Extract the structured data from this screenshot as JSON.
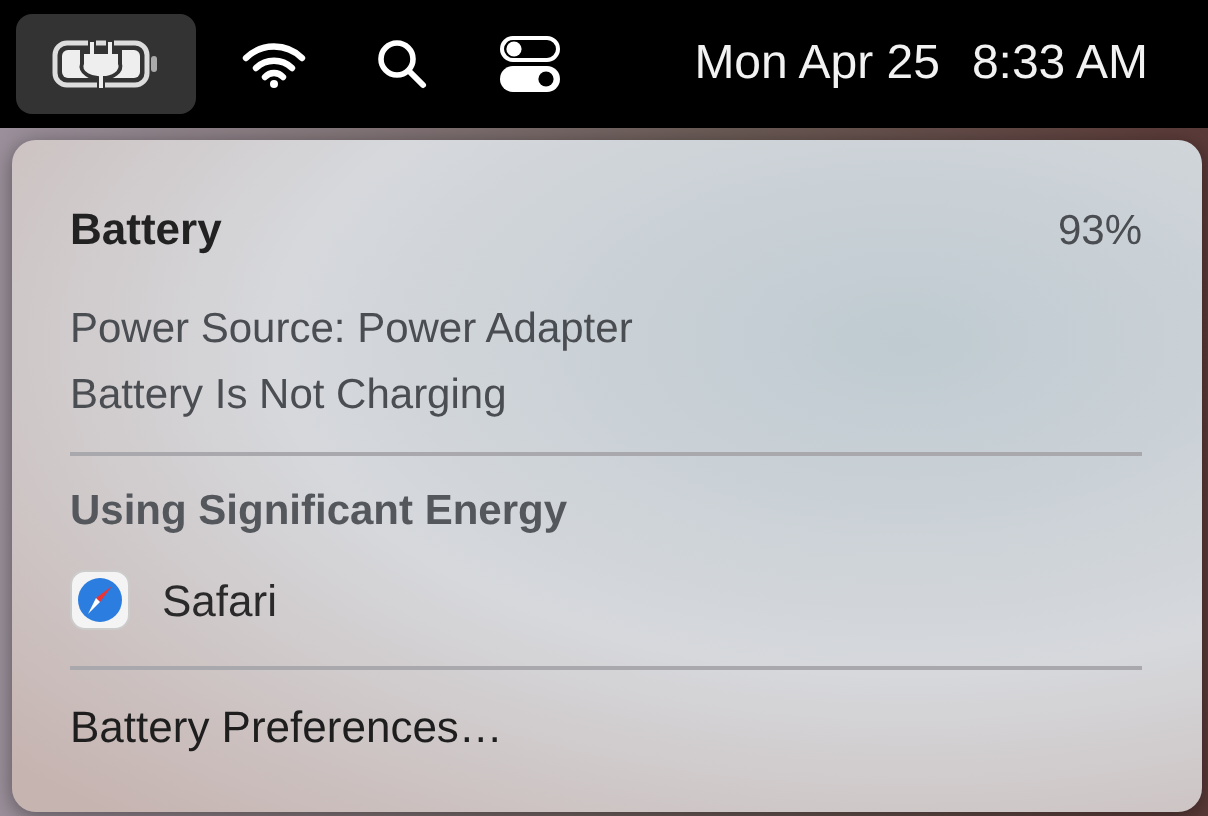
{
  "menu_bar": {
    "status_items": [
      {
        "kind": "battery",
        "selected": true
      },
      {
        "kind": "wifi",
        "selected": false
      },
      {
        "kind": "search",
        "selected": false
      },
      {
        "kind": "control-center",
        "selected": false
      }
    ],
    "date": "Mon Apr 25",
    "time": "8:33 AM"
  },
  "battery_menu": {
    "title": "Battery",
    "percentage": "93%",
    "details": [
      "Power Source: Power Adapter",
      "Battery Is Not Charging"
    ],
    "energy_section": {
      "heading": "Using Significant Energy",
      "apps": [
        {
          "name": "Safari"
        }
      ]
    },
    "preferences_item": "Battery Preferences…"
  }
}
